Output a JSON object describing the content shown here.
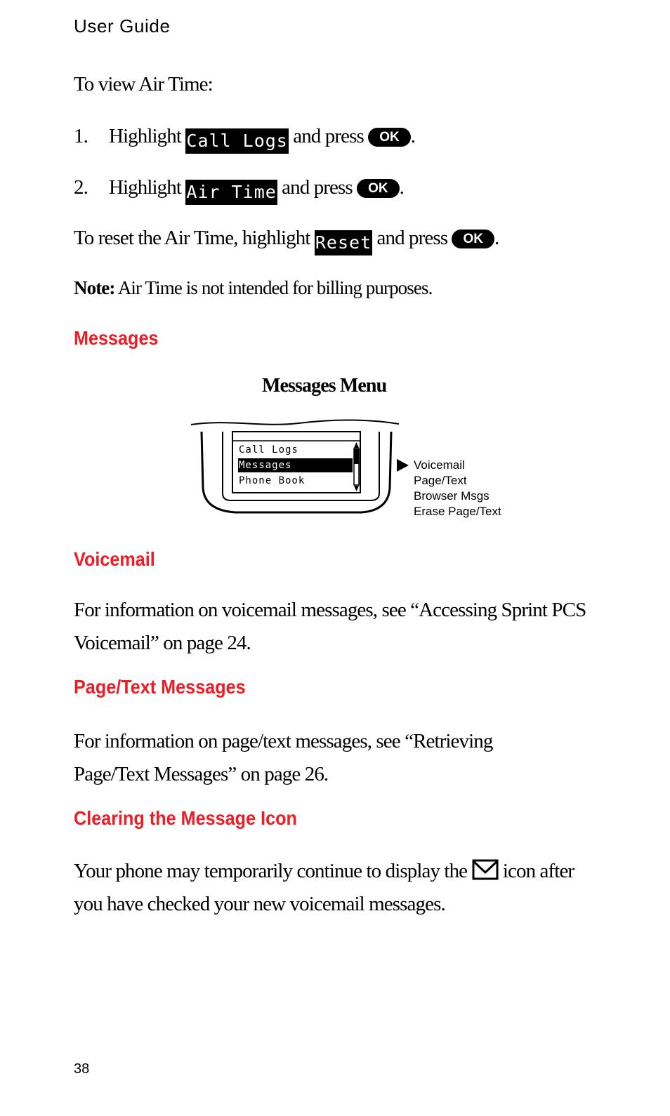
{
  "header": {
    "title": "User Guide"
  },
  "intro": "To view Air Time:",
  "steps": [
    {
      "num": "1.",
      "pre": "Highlight",
      "lcd": "Call Logs",
      "mid": "and press",
      "key": "OK",
      "end": "."
    },
    {
      "num": "2.",
      "pre": "Highlight",
      "lcd": "Air Time",
      "mid": "and press",
      "key": "OK",
      "end": "."
    }
  ],
  "reset": {
    "pre": "To reset the Air Time, highlight",
    "lcd": "Reset",
    "mid": "and press",
    "key": "OK",
    "end": "."
  },
  "note": {
    "label": "Note:",
    "text": " Air Time is not intended for billing purposes."
  },
  "sections": {
    "messages": "Messages",
    "voicemail": "Voicemail",
    "pagetext": "Page/Text Messages",
    "clearing": "Clearing the Message Icon"
  },
  "figure": {
    "title": "Messages Menu",
    "screen_items": [
      "Call Logs",
      "Messages",
      "Phone Book"
    ],
    "selected": "Messages",
    "submenu": [
      "Voicemail",
      "Page/Text",
      "Browser Msgs",
      "Erase Page/Text"
    ]
  },
  "voicemail_text": [
    "For information on voicemail messages, see “Accessing Sprint PCS",
    "Voicemail” on page 24."
  ],
  "pagetext_text": [
    "For information on page/text messages, see “Retrieving",
    "Page/Text Messages” on page 26."
  ],
  "clearing_text": {
    "pre": "Your phone may temporarily continue to display the",
    "icon": "envelope-icon",
    "post": "icon after",
    "line2": "you have checked your new voicemail messages."
  },
  "page_number": "38",
  "colors": {
    "heading": "#ee1c24"
  }
}
